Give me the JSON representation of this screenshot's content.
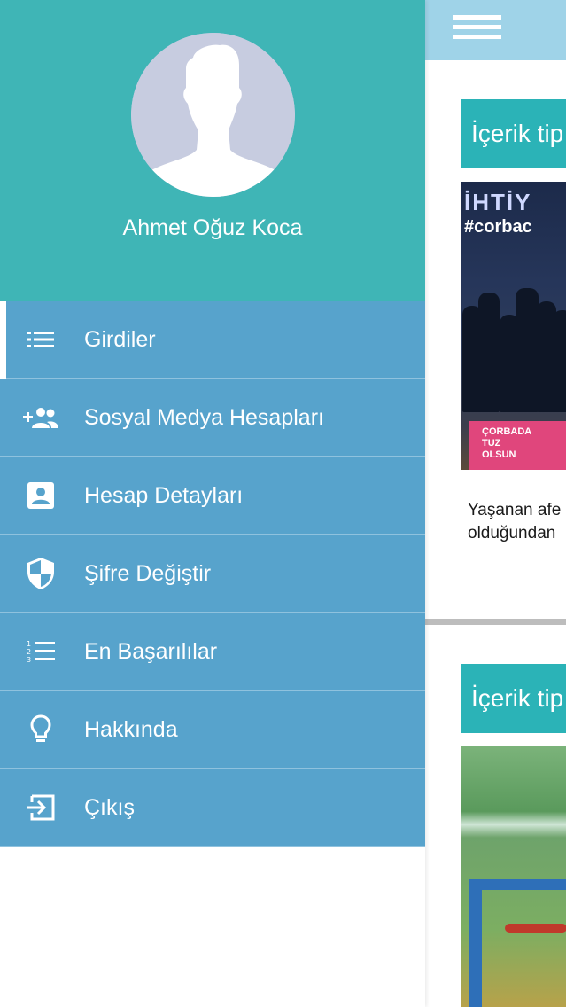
{
  "colors": {
    "drawer_profile_bg": "#3fb5b6",
    "menu_bg": "#57a3cc",
    "menu_divider": "#8fc2de",
    "topbar_bg": "#9fd3e8",
    "card_header_bg": "#2bb3b7",
    "text_white": "#ffffff"
  },
  "profile": {
    "name": "Ahmet Oğuz Koca",
    "avatar_icon": "default-person-silhouette"
  },
  "menu": {
    "items": [
      {
        "label": "Girdiler",
        "icon": "list-icon",
        "active": true
      },
      {
        "label": "Sosyal Medya Hesapları",
        "icon": "add-group-icon",
        "active": false
      },
      {
        "label": "Hesap Detayları",
        "icon": "account-box-icon",
        "active": false
      },
      {
        "label": "Şifre Değiştir",
        "icon": "shield-icon",
        "active": false
      },
      {
        "label": "En Başarılılar",
        "icon": "ranked-list-icon",
        "active": false
      },
      {
        "label": "Hakkında",
        "icon": "lightbulb-icon",
        "active": false
      },
      {
        "label": "Çıkış",
        "icon": "logout-icon",
        "active": false
      }
    ]
  },
  "content": {
    "topbar": {
      "menu_icon": "hamburger-icon"
    },
    "cards": [
      {
        "header": "İçerik tip",
        "image_text_1": "ÇORB",
        "image_text_2": "İHTİY",
        "image_text_3": "#corbac",
        "image_badge": "ÇORBADA\nTUZ\nOLSUN",
        "text": "Yaşanan afe\nolduğundan"
      },
      {
        "header": "İçerik tip"
      }
    ]
  }
}
